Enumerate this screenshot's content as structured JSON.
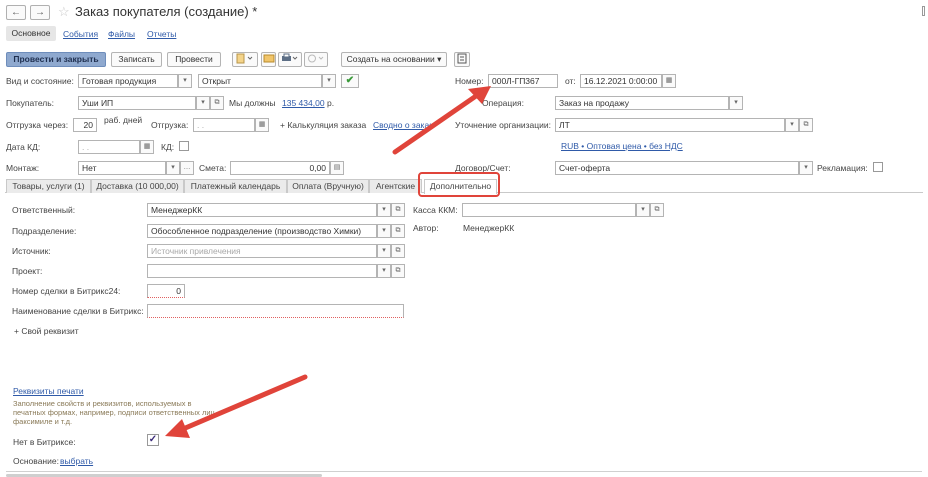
{
  "window": {
    "title": "Заказ покупателя (создание) *",
    "back_icon": "←",
    "forward_icon": "→",
    "star_icon": "☆"
  },
  "nav_tabs": [
    "Основное",
    "События",
    "Файлы",
    "Отчеты"
  ],
  "toolbar": {
    "post_close": "Провести и закрыть",
    "save": "Записать",
    "post": "Провести",
    "create_based": "Создать на основании"
  },
  "header": {
    "state_label": "Вид и состояние:",
    "state_type": "Готовая продукция",
    "state_status": "Открыт",
    "number_label": "Номер:",
    "number_value": "000Л-ГП367",
    "date_label": "от:",
    "date_value": "16.12.2021  0:00:00",
    "customer_label": "Покупатель:",
    "customer_value": "Уши ИП",
    "debt_prefix": "Мы должны",
    "debt_amount": "135 434,00",
    "debt_currency": "р.",
    "operation_label": "Операция:",
    "operation_value": "Заказ на продажу",
    "ship_after_label": "Отгрузка через:",
    "ship_after_value": "20",
    "ship_after_unit": "раб. дней",
    "ship_label": "Отгрузка:",
    "ship_value": ". .",
    "calc_label": "+ Калькуляция заказа",
    "summary_link": "Сводно о заказе",
    "org_label": "Уточнение организации:",
    "org_value": "ЛТ",
    "kd_date_label": "Дата КД:",
    "kd_date_value": ". .",
    "kd_label": "КД:",
    "price_link": "RUB • Оптовая цена • без НДС",
    "mount_label": "Монтаж:",
    "mount_value": "Нет",
    "estimate_label": "Смета:",
    "estimate_value": "0,00",
    "contract_label": "Договор/Счет:",
    "contract_value": "Счет-оферта",
    "reclamation_label": "Рекламация:"
  },
  "tabs": [
    "Товары, услуги (1)",
    "Доставка (10 000,00)",
    "Платежный календарь",
    "Оплата (Вручную)",
    "Агентские",
    "Дополнительно"
  ],
  "extra": {
    "responsible_label": "Ответственный:",
    "responsible_value": "МенеджерКК",
    "cash_label": "Касса ККМ:",
    "division_label": "Подразделение:",
    "division_value": "Обособленное подразделение (производство Химки)",
    "author_label": "Автор:",
    "author_value": "МенеджерКК",
    "source_label": "Источник:",
    "source_placeholder": "Источник привлечения",
    "project_label": "Проект:",
    "deal_number_label": "Номер сделки в Битрикс24:",
    "deal_number_value": "0",
    "deal_name_label": "Наименование сделки в Битрикс:",
    "custom_prop": "+ Свой реквизит",
    "print_props_link": "Реквизиты печати",
    "print_hint": [
      "Заполнение свойств и реквизитов, используемых в",
      "печатных формах, например, подписи ответственных лиц,",
      "факсимиле и т.д."
    ],
    "not_in_bitrix_label": "Нет в Битриксе:",
    "basis_label": "Основание:",
    "basis_link": "выбрать"
  },
  "colors": {
    "accent": "#e0443a",
    "link": "#2f5aa8",
    "primary_button": "#8fa9cf",
    "check_green": "#3a9a3a"
  }
}
